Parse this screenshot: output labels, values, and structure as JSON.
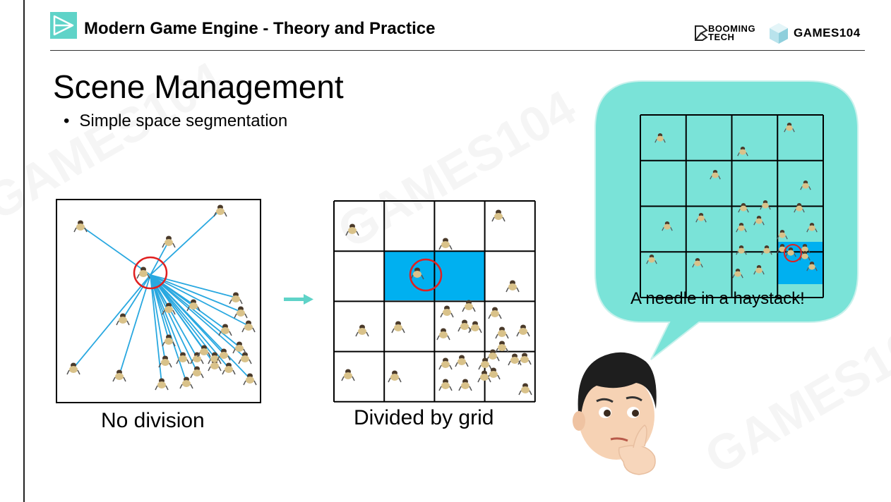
{
  "header": {
    "title": "Modern Game Engine - Theory and Practice",
    "brand_booming_line1": "BOOMING",
    "brand_booming_line2": "TECH",
    "brand_games": "GAMES104"
  },
  "slide": {
    "title": "Scene Management",
    "bullet": "Simple space segmentation"
  },
  "figures": {
    "no_division_label": "No division",
    "grid_label": "Divided by grid",
    "bubble_text": "A needle in a haystack!"
  },
  "watermarks": [
    "GAMES104",
    "BOOMING TECH"
  ],
  "colors": {
    "accent_teal": "#5fd3c8",
    "bubble_teal": "#7ae3d8",
    "cell_highlight": "#00b0f0",
    "line_blue": "#29a8e0",
    "circle_red": "#e02020"
  },
  "icons": {
    "logo": "play-triangle-icon",
    "arrow": "right-arrow-icon",
    "avatar": "thinking-person-avatar"
  }
}
